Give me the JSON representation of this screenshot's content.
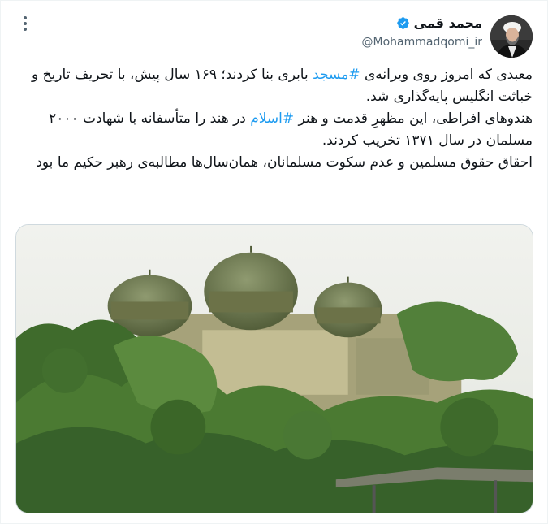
{
  "author": {
    "display_name": "محمد قمی",
    "handle": "@Mohammadqomi_ir",
    "verified": true
  },
  "icons": {
    "more": "more-vertical-icon",
    "verified": "verified-badge-icon"
  },
  "colors": {
    "link": "#1d9bf0",
    "verified": "#1d9bf0",
    "text": "#0f1419",
    "muted": "#536471"
  },
  "tweet": {
    "p1": {
      "t1": "معبدی که امروز روی ویرانه‌ی ",
      "h1": "#مسجد",
      "t2": " بابری بنا کردند؛ ۱۶۹ سال پیش، با تحریف تاریخ و خباثت انگلیس پایه‌گذاری شد."
    },
    "p2": {
      "t1": "هندوهای افراطی، این مظهرِ قدمت و هنر ",
      "h1": "#اسلام",
      "t2": " در هند را متأسفانه با شهادت ۲۰۰۰ مسلمان در سال ۱۳۷۱ تخریب کردند."
    },
    "p3": "احقاق حقوق مسلمین و عدم سکوت مسلمانان، همان‌سال‌ها مطالبه‌ی رهبر حکیم ما بود"
  }
}
